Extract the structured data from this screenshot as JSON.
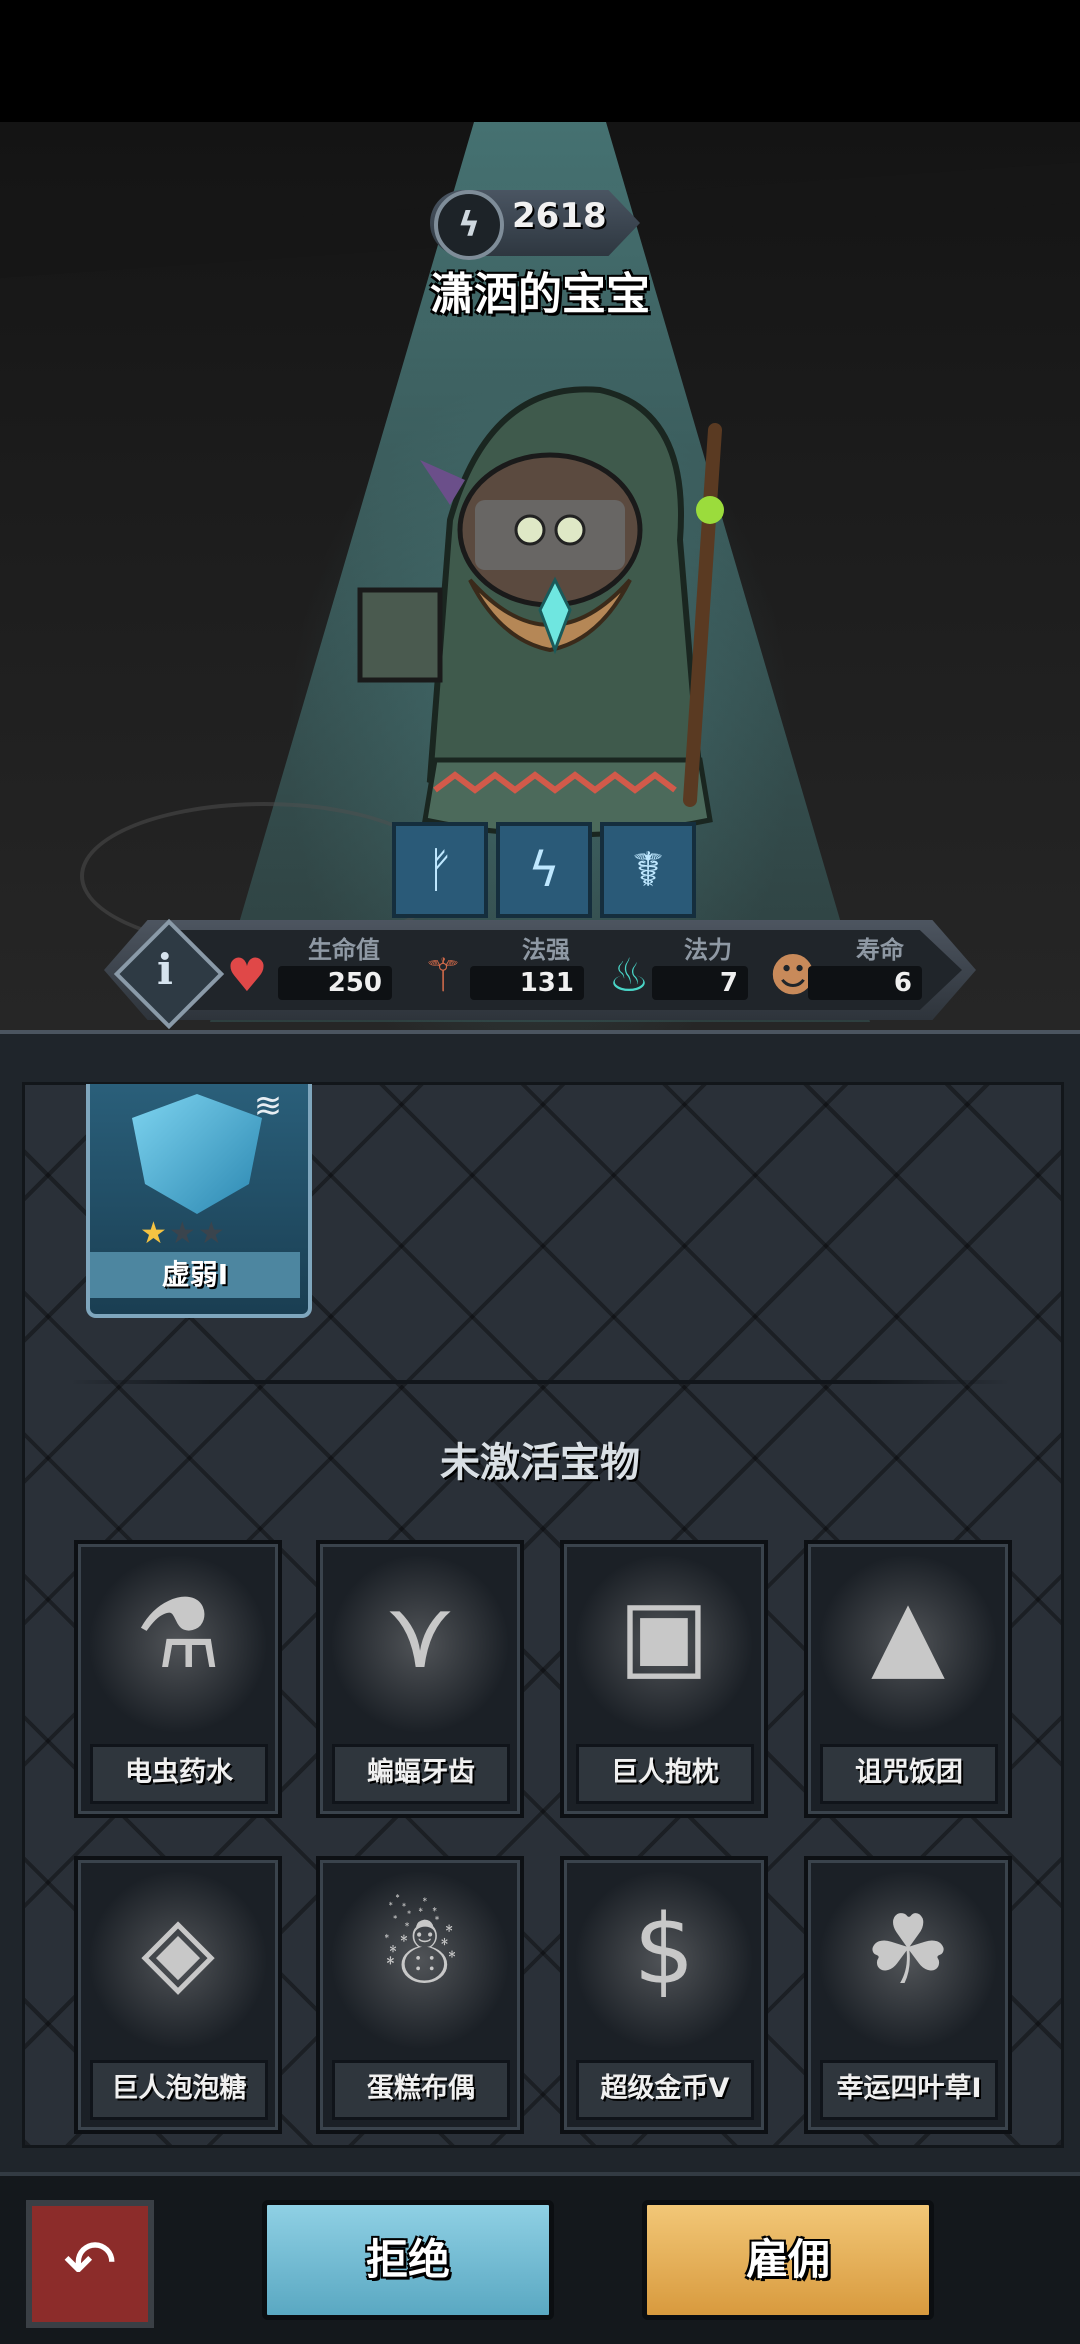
{
  "hero": {
    "power": "2618",
    "name": "潇洒的宝宝"
  },
  "skills": [
    {
      "icon": "rune-figure-icon"
    },
    {
      "icon": "rune-lightning-icon"
    },
    {
      "icon": "rune-caduceus-icon"
    }
  ],
  "stats": {
    "hp_label": "生命值",
    "hp_value": "250",
    "power_label": "法强",
    "power_value": "131",
    "mana_label": "法力",
    "mana_value": "7",
    "life_label": "寿命",
    "life_value": "6"
  },
  "active_card": {
    "label": "虚弱I",
    "stars_filled": 1,
    "stars_total": 3
  },
  "inactive_section": {
    "title": "未激活宝物",
    "items": [
      {
        "label": "电虫药水",
        "icon": "potion-vial-icon"
      },
      {
        "label": "蝙蝠牙齿",
        "icon": "bat-teeth-icon"
      },
      {
        "label": "巨人抱枕",
        "icon": "giant-pillow-icon"
      },
      {
        "label": "诅咒饭团",
        "icon": "cursed-riceball-icon"
      },
      {
        "label": "巨人泡泡糖",
        "icon": "giant-bubblegum-icon"
      },
      {
        "label": "蛋糕布偶",
        "icon": "cake-doll-icon"
      },
      {
        "label": "超级金币V",
        "icon": "super-coin-icon"
      },
      {
        "label": "幸运四叶草I",
        "icon": "four-leaf-clover-icon"
      }
    ]
  },
  "buttons": {
    "reject": "拒绝",
    "hire": "雇佣"
  }
}
